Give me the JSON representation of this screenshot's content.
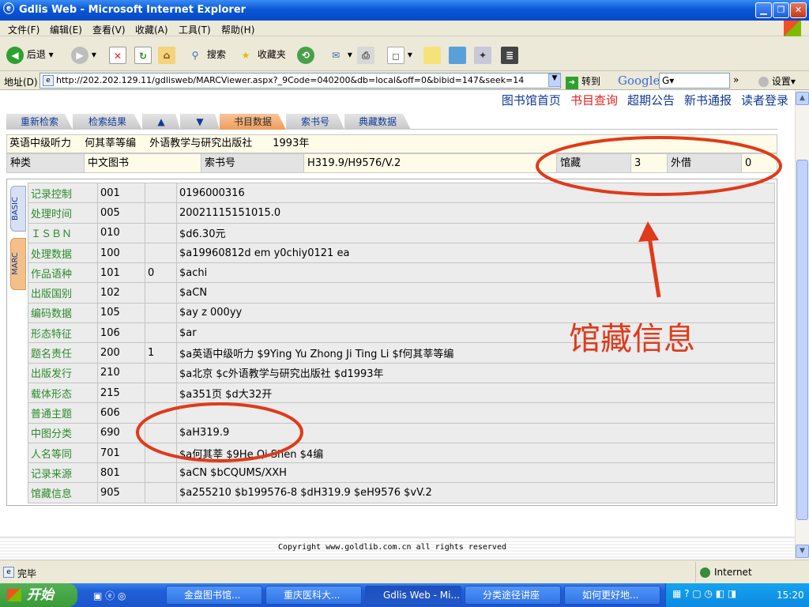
{
  "window": {
    "title": "Gdlis Web - Microsoft Internet Explorer"
  },
  "menu": [
    "文件(F)",
    "编辑(E)",
    "查看(V)",
    "收藏(A)",
    "工具(T)",
    "帮助(H)"
  ],
  "toolbar": {
    "back": "后退",
    "search": "搜索",
    "favorites": "收藏夹"
  },
  "address": {
    "label": "地址(D)",
    "url": "http://202.202.129.11/gdlisweb/MARCViewer.aspx?_9Code=040200&db=local&off=0&bibid=147&seek=14",
    "go": "转到",
    "google": "Google",
    "google_box": "G▾",
    "settings": "设置▾"
  },
  "site_nav": [
    "图书馆首页",
    "书目查询",
    "超期公告",
    "新书通报",
    "读者登录"
  ],
  "tabs": [
    "重新检索",
    "检索结果",
    "▲",
    "▼",
    "书目数据",
    "索书号",
    "典藏数据"
  ],
  "info_line": "英语中级听力　 何其莘等编　 外语教学与研究出版社　　1993年",
  "info_row": {
    "kind_label": "种类",
    "kind_value": "中文图书",
    "callno_label": "索书号",
    "callno_value": "H319.9/H9576/V.2",
    "holdings_label": "馆藏",
    "holdings_value": "3",
    "loan_label": "外借",
    "loan_value": "0"
  },
  "side_tabs": [
    "BASIC",
    "MARC"
  ],
  "marc_rows": [
    {
      "field": "记录控制",
      "tag": "001",
      "ind": "",
      "value": "0196000316"
    },
    {
      "field": "处理时间",
      "tag": "005",
      "ind": "",
      "value": "20021115151015.0"
    },
    {
      "field": "ＩＳＢＮ",
      "tag": "010",
      "ind": "",
      "value": "$d6.30元"
    },
    {
      "field": "处理数据",
      "tag": "100",
      "ind": "",
      "value": "$a19960812d em y0chiy0121 ea"
    },
    {
      "field": "作品语种",
      "tag": "101",
      "ind": "0",
      "value": "$achi"
    },
    {
      "field": "出版国别",
      "tag": "102",
      "ind": "",
      "value": "$aCN"
    },
    {
      "field": "编码数据",
      "tag": "105",
      "ind": "",
      "value": "$ay z 000yy"
    },
    {
      "field": "形态特征",
      "tag": "106",
      "ind": "",
      "value": "$ar"
    },
    {
      "field": "题名责任",
      "tag": "200",
      "ind": "1",
      "value": "$a英语中级听力  $9Ying Yu Zhong Ji Ting Li $f何其莘等编"
    },
    {
      "field": "出版发行",
      "tag": "210",
      "ind": "",
      "value": "$a北京  $c外语教学与研究出版社  $d1993年"
    },
    {
      "field": "载体形态",
      "tag": "215",
      "ind": "",
      "value": "$a351页  $d大32开"
    },
    {
      "field": "普通主题",
      "tag": "606",
      "ind": "",
      "value": ""
    },
    {
      "field": "中图分类",
      "tag": "690",
      "ind": "",
      "value": "$aH319.9"
    },
    {
      "field": "人名等同",
      "tag": "701",
      "ind": "",
      "value": "$a何其莘  $9He Qi Shen $4编"
    },
    {
      "field": "记录来源",
      "tag": "801",
      "ind": "",
      "value": "$aCN $bCQUMS/XXH"
    },
    {
      "field": "馆藏信息",
      "tag": "905",
      "ind": "",
      "value": "$a255210 $b199576-8 $dH319.9 $eH9576 $vV.2"
    }
  ],
  "annotation": {
    "text": "馆藏信息",
    "color": "#e03a1a"
  },
  "footer": {
    "copyright": "Copyright www.goldlib.com.cn all rights reserved"
  },
  "status": {
    "text": "完毕",
    "zone": "Internet"
  },
  "taskbar": {
    "start": "开始",
    "tasks": [
      "金盘图书馆...",
      "重庆医科大...",
      "Gdlis Web - Mi...",
      "分类途径讲座",
      "如何更好地..."
    ],
    "clock": "15:20"
  }
}
